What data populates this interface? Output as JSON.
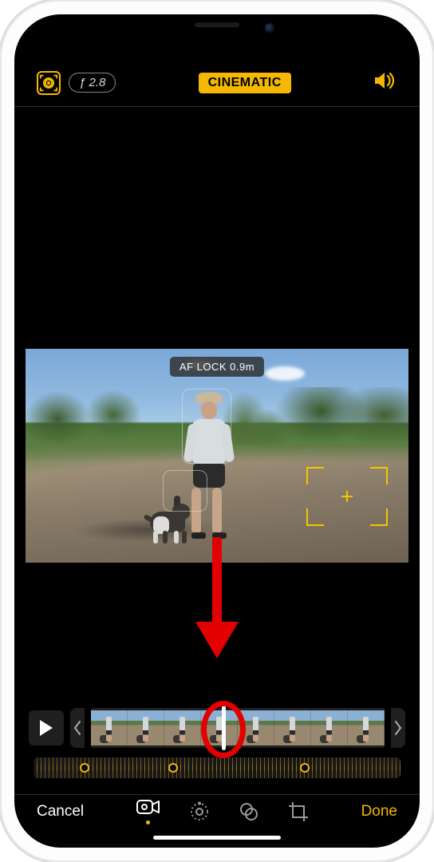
{
  "header": {
    "aperture_label": "ƒ 2.8",
    "mode_badge": "CINEMATIC"
  },
  "preview": {
    "af_lock_label": "AF LOCK 0.9m"
  },
  "keyframes": {
    "positions_pct": [
      14,
      38,
      74
    ]
  },
  "bottom": {
    "cancel": "Cancel",
    "done": "Done"
  },
  "colors": {
    "accent": "#f5b800",
    "annotation": "#e20000"
  }
}
